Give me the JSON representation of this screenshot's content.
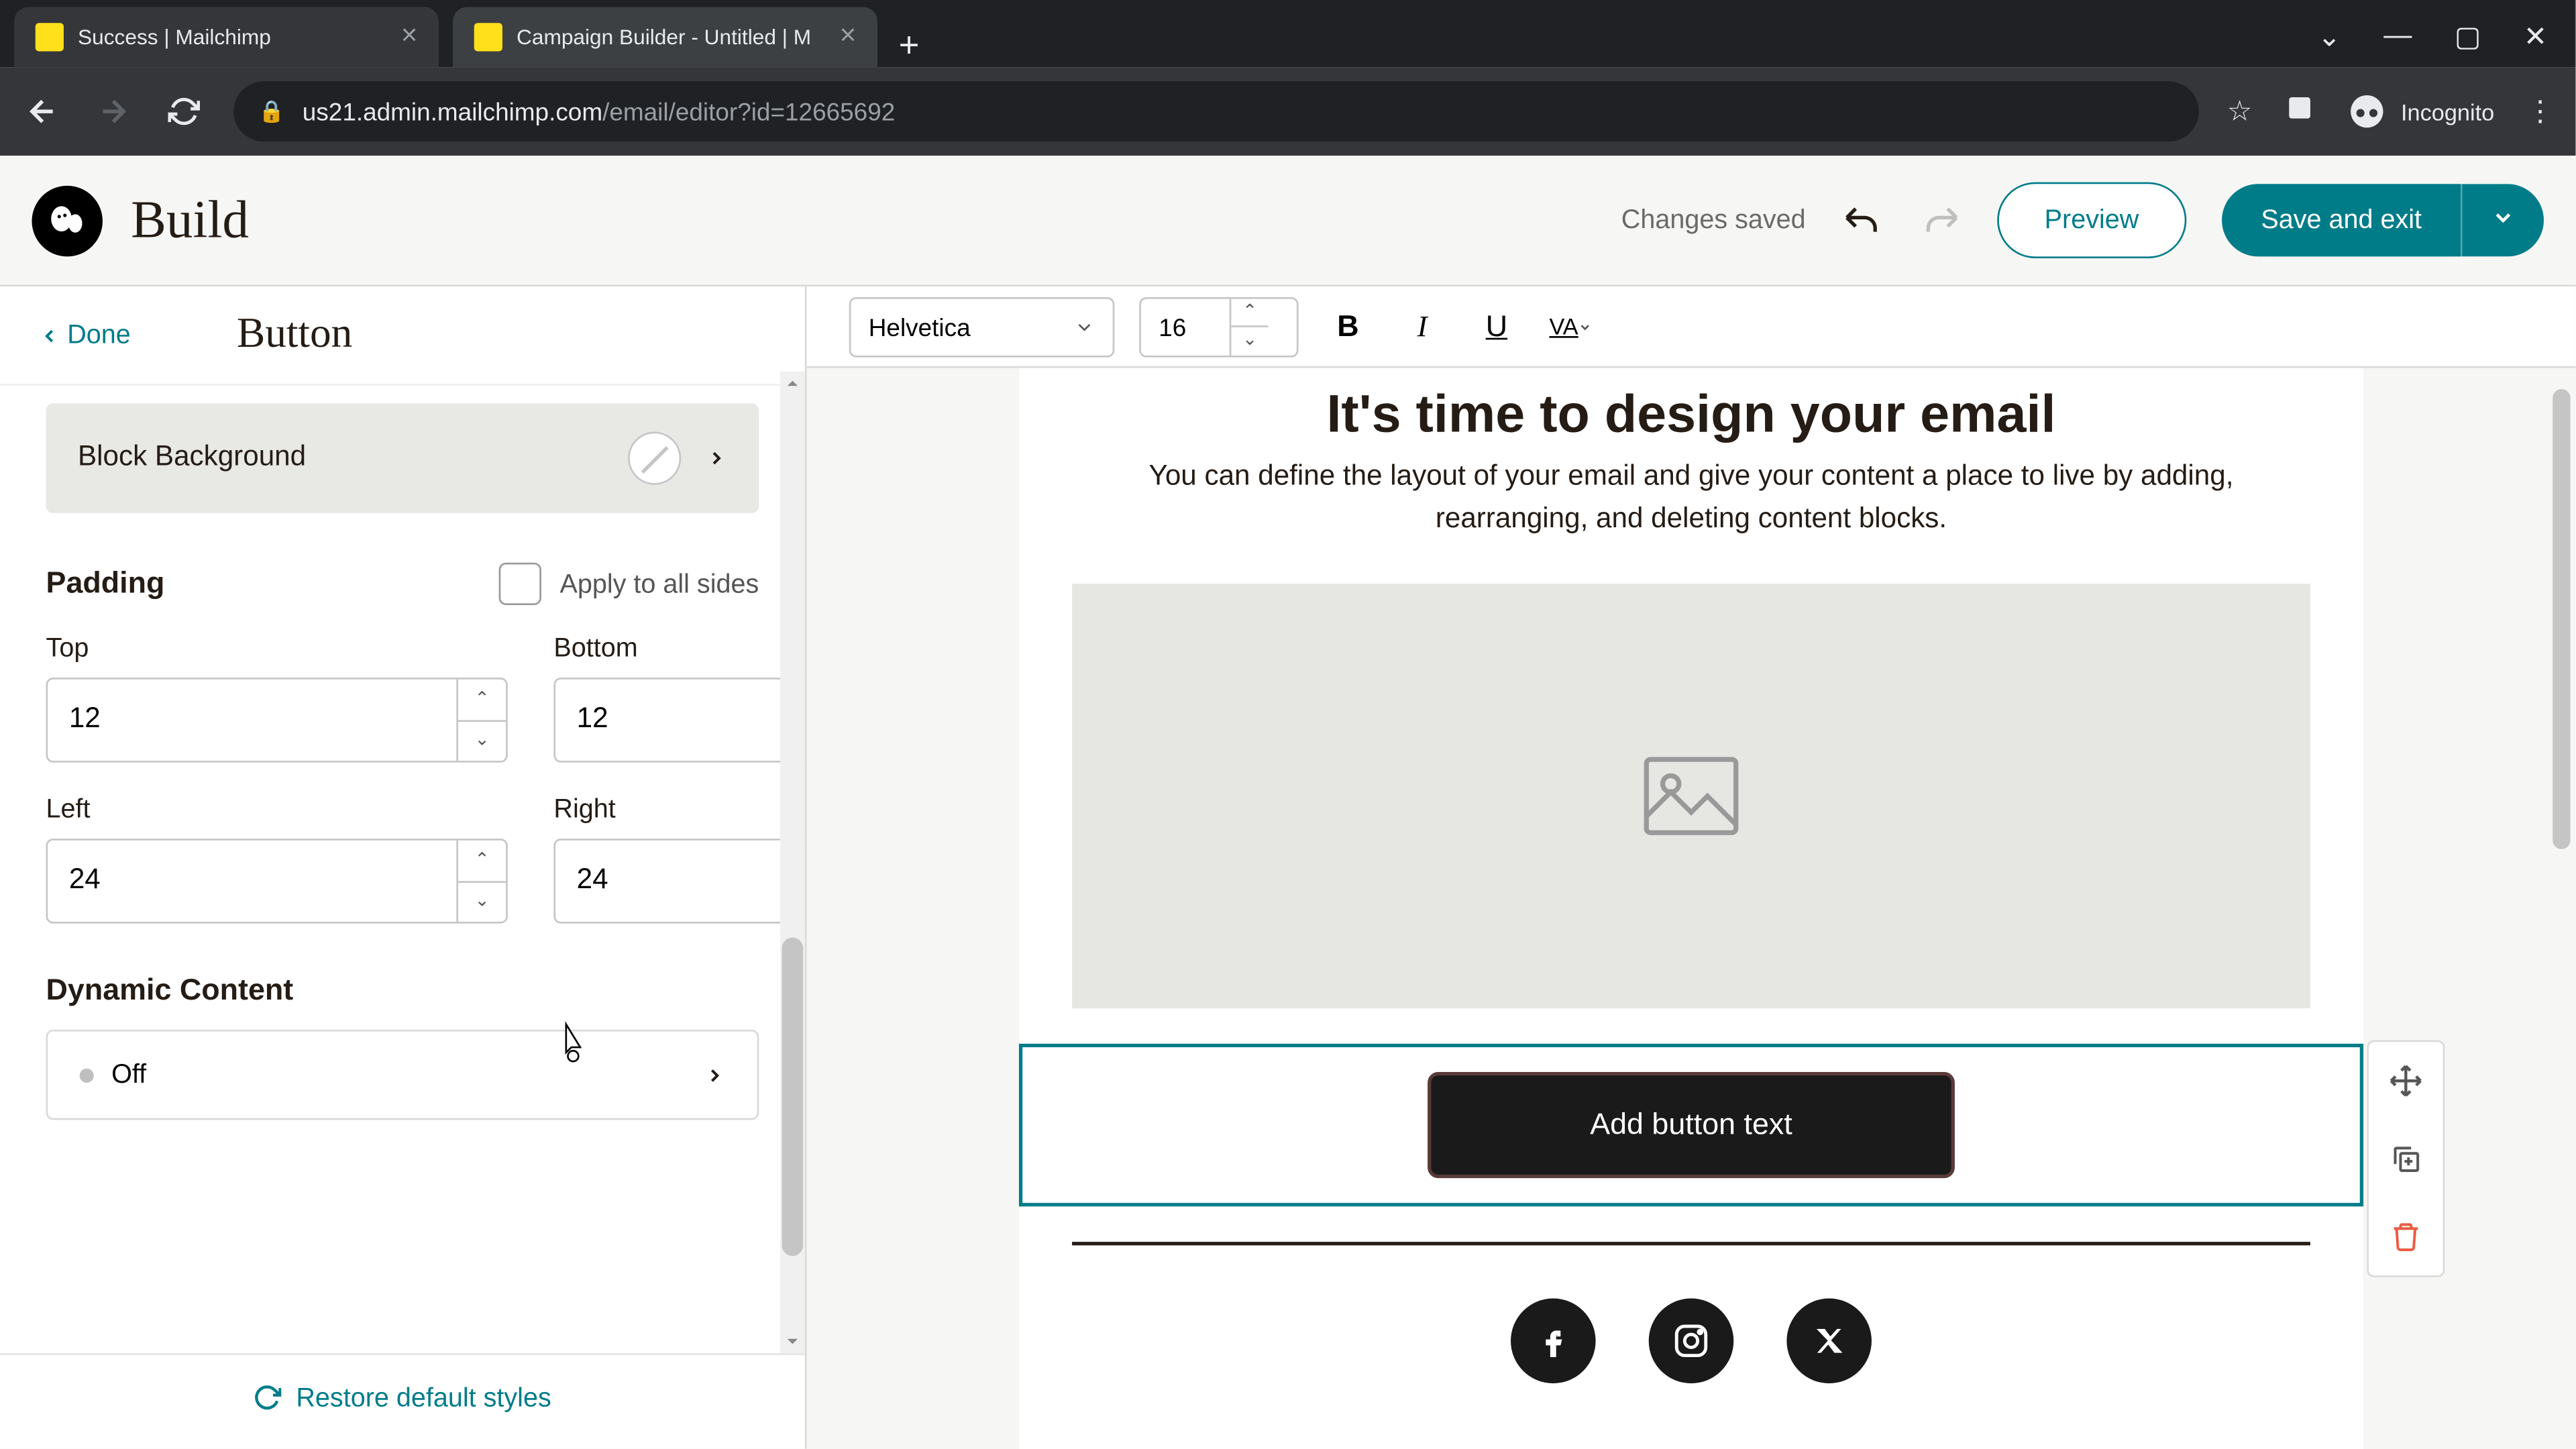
{
  "browser": {
    "tabs": [
      {
        "title": "Success | Mailchimp"
      },
      {
        "title": "Campaign Builder - Untitled | M"
      }
    ],
    "url_host": "us21.admin.mailchimp.com",
    "url_path": "/email/editor?id=12665692",
    "incognito_label": "Incognito"
  },
  "header": {
    "title": "Build",
    "status": "Changes saved",
    "preview": "Preview",
    "save": "Save and exit"
  },
  "sidebar": {
    "done": "Done",
    "panel_title": "Button",
    "block_bg": "Block Background",
    "padding_title": "Padding",
    "apply_all": "Apply to all sides",
    "top_label": "Top",
    "top_val": "12",
    "bottom_label": "Bottom",
    "bottom_val": "12",
    "left_label": "Left",
    "left_val": "24",
    "right_label": "Right",
    "right_val": "24",
    "dyn_title": "Dynamic Content",
    "dyn_state": "Off",
    "restore": "Restore default styles"
  },
  "toolbar": {
    "font": "Helvetica",
    "size": "16"
  },
  "email": {
    "heading": "It's time to design your email",
    "subtitle": "You can define the layout of your email and give your content a place to live by adding, rearranging, and deleting content blocks.",
    "button_text": "Add button text"
  },
  "colors": {
    "teal": "#007c89"
  }
}
